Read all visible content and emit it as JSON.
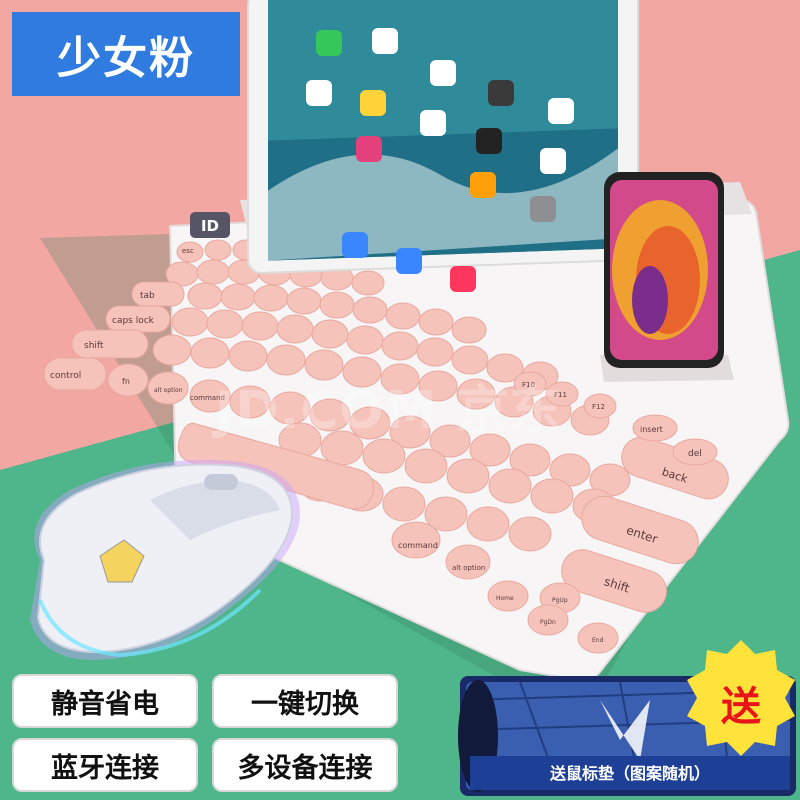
{
  "title_badge": "少女粉",
  "features": [
    "静音省电",
    "一键切换",
    "蓝牙连接",
    "多设备连接"
  ],
  "gift": {
    "badge": "送",
    "caption": "送鼠标垫（图案随机）"
  },
  "watermark": "JD.COM 京东",
  "keyboard": {
    "logo": "ID",
    "key_labels": [
      "esc",
      "tab",
      "caps lock",
      "shift",
      "control",
      "fn",
      "alt option",
      "command",
      "command",
      "alt option",
      "back",
      "enter",
      "shift",
      "insert",
      "del",
      "Home",
      "PgUp",
      "PgDn",
      "End",
      "F10",
      "F11",
      "F12"
    ]
  },
  "colors": {
    "bg_pink": "#f2a7a2",
    "bg_green": "#4fb58a",
    "keyboard_body": "#f7f5f6",
    "key_pink": "#f6c3bb",
    "badge_blue": "#2f7be0",
    "gift_red": "#e8141b",
    "gift_yellow": "#ffe33a"
  }
}
